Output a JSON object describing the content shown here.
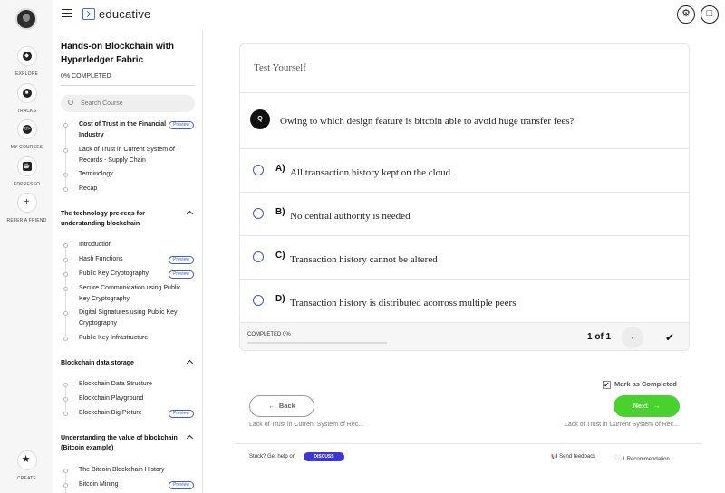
{
  "brand": {
    "name": "educative",
    "accent": "#3b6ee8"
  },
  "rail": {
    "items": [
      {
        "label": "EXPLORE",
        "icon": "explore-icon"
      },
      {
        "label": "TRACKS",
        "icon": "tracks-icon"
      },
      {
        "label": "MY COURSES",
        "icon": "my-courses-icon"
      },
      {
        "label": "EDPRESSO",
        "icon": "coffee-icon"
      },
      {
        "label": "REFER A FRIEND",
        "icon": "add-user-icon"
      }
    ],
    "create": "CREATE"
  },
  "course": {
    "title": "Hands-on Blockchain with Hyperledger Fabric",
    "progress": "0% COMPLETED",
    "progress_value": 0,
    "search_placeholder": "Search Course",
    "preview_label": "Preview",
    "lessons_top": [
      {
        "title": "Cost of Trust in the Financial Industry",
        "preview": true,
        "current": true
      },
      {
        "title": "Lack of Trust in Current System of Records - Supply Chain",
        "preview": false
      },
      {
        "title": "Terminology",
        "preview": false
      },
      {
        "title": "Recap",
        "preview": false
      }
    ],
    "sections": [
      {
        "title": "The technology pre-reqs for understanding blockchain",
        "lessons": [
          {
            "title": "Introduction",
            "preview": false
          },
          {
            "title": "Hash Functions",
            "preview": true
          },
          {
            "title": "Public Key Cryptography",
            "preview": true
          },
          {
            "title": "Secure Communication using Public Key Cryptography",
            "preview": false
          },
          {
            "title": "Digital Signatures using Public Key Cryptography",
            "preview": false
          },
          {
            "title": "Public Key Infrastructure",
            "preview": false
          }
        ]
      },
      {
        "title": "Blockchain data storage",
        "lessons": [
          {
            "title": "Blockchain Data Structure",
            "preview": false
          },
          {
            "title": "Blockchain Playground",
            "preview": false
          },
          {
            "title": "Blockchain Big Picture",
            "preview": true
          }
        ]
      },
      {
        "title": "Understanding the value of blockchain (Bitcoin example)",
        "lessons": [
          {
            "title": "The Bitcoin Blockchain History",
            "preview": false
          },
          {
            "title": "Bitcoin Mining",
            "preview": true
          }
        ]
      }
    ]
  },
  "quiz": {
    "heading": "Test Yourself",
    "q_badge": "Q",
    "question": "Owing to which design feature is bitcoin able to avoid huge transfer fees?",
    "options": [
      {
        "letter": "A)",
        "text": "All transaction history kept on the cloud"
      },
      {
        "letter": "B)",
        "text": "No central authority is needed"
      },
      {
        "letter": "C)",
        "text": "Transaction history cannot be altered"
      },
      {
        "letter": "D)",
        "text": "Transaction history is distributed acorross multiple peers"
      }
    ],
    "completed": "COMPLETED 0%",
    "count": "1 of 1"
  },
  "nav": {
    "mark_completed": "Mark as Completed",
    "back": "Back",
    "next": "Next",
    "prev_lesson": "Lack of Trust in Current System of Rec...",
    "next_lesson": "Lack of Trust in Current System of Rec...",
    "next_color": "#49d22e"
  },
  "footer": {
    "stuck": "Stuck? Get help on",
    "discuss": "DISCUSS",
    "feedback": "Send feedback",
    "recommendation": "1 Recommendation"
  }
}
